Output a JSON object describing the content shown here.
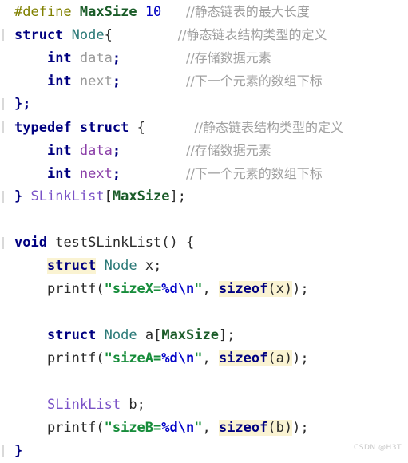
{
  "editor": {
    "background": "#ffffff",
    "language": "C",
    "theme": "light"
  },
  "colors": {
    "preprocessor": "#808000",
    "keyword": "#000080",
    "macro_constant": "#1a5c28",
    "number": "#0000c0",
    "type_name": "#2b7a78",
    "plain": "#2b2b2b",
    "dim_member": "#9a9a9a",
    "purple_member": "#8b3fa8",
    "typedef_alias": "#7a52c7",
    "comment": "#a0a0a0",
    "string": "#168c3a",
    "escape": "#0000c8",
    "highlight_background": "#faf3d2"
  },
  "code": {
    "line01": {
      "define_kw": "#define",
      "macro_name": "MaxSize",
      "macro_value": "10",
      "comment": "//静态链表的最大长度"
    },
    "line02": {
      "kw_struct": "struct",
      "type_name": "Node",
      "brace": "{",
      "comment": "//静态链表结构类型的定义"
    },
    "line03": {
      "kw_int": "int",
      "member": "data",
      "semi": ";",
      "comment": "//存储数据元素"
    },
    "line04": {
      "kw_int": "int",
      "member": "next",
      "semi": ";",
      "comment": "//下一个元素的数组下标"
    },
    "line05": {
      "text": "};"
    },
    "line06": {
      "kw_typedef": "typedef",
      "kw_struct": "struct",
      "brace": "{",
      "comment": "//静态链表结构类型的定义"
    },
    "line07": {
      "kw_int": "int",
      "member": "data",
      "semi": ";",
      "comment": "//存储数据元素"
    },
    "line08": {
      "kw_int": "int",
      "member": "next",
      "semi": ";",
      "comment": "//下一个元素的数组下标"
    },
    "line09": {
      "close_brace": "}",
      "alias": "SLinkList",
      "bracket_open": "[",
      "macro_name": "MaxSize",
      "bracket_close": "];"
    },
    "line10": {
      "text": ""
    },
    "line11": {
      "kw_void": "void",
      "func_name": "testSLinkList()",
      "brace": "{"
    },
    "line12": {
      "kw_struct": "struct",
      "type_name": "Node",
      "var": "x;"
    },
    "line13": {
      "call": "printf(",
      "string_open": "\"sizeX=",
      "escape_d": "%d",
      "escape_n": "\\n",
      "string_close": "\"",
      "comma": ", ",
      "sizeof_kw": "sizeof",
      "sizeof_arg": "(x)",
      "tail": ");"
    },
    "line14": {
      "text": ""
    },
    "line15": {
      "kw_struct": "struct",
      "type_name": "Node",
      "var": "a",
      "bracket_open": "[",
      "macro_name": "MaxSize",
      "bracket_close": "];"
    },
    "line16": {
      "call": "printf(",
      "string_open": "\"sizeA=",
      "escape_d": "%d",
      "escape_n": "\\n",
      "string_close": "\"",
      "comma": ", ",
      "sizeof_kw": "sizeof",
      "sizeof_arg": "(a)",
      "tail": ");"
    },
    "line17": {
      "text": ""
    },
    "line18": {
      "alias": "SLinkList",
      "var": "b;"
    },
    "line19": {
      "call": "printf(",
      "string_open": "\"sizeB=",
      "escape_d": "%d",
      "escape_n": "\\n",
      "string_close": "\"",
      "comma": ", ",
      "sizeof_kw": "sizeof",
      "sizeof_arg": "(b)",
      "tail": ");"
    },
    "line20": {
      "text": "}"
    }
  },
  "watermark": {
    "text": "CSDN @H3T"
  }
}
